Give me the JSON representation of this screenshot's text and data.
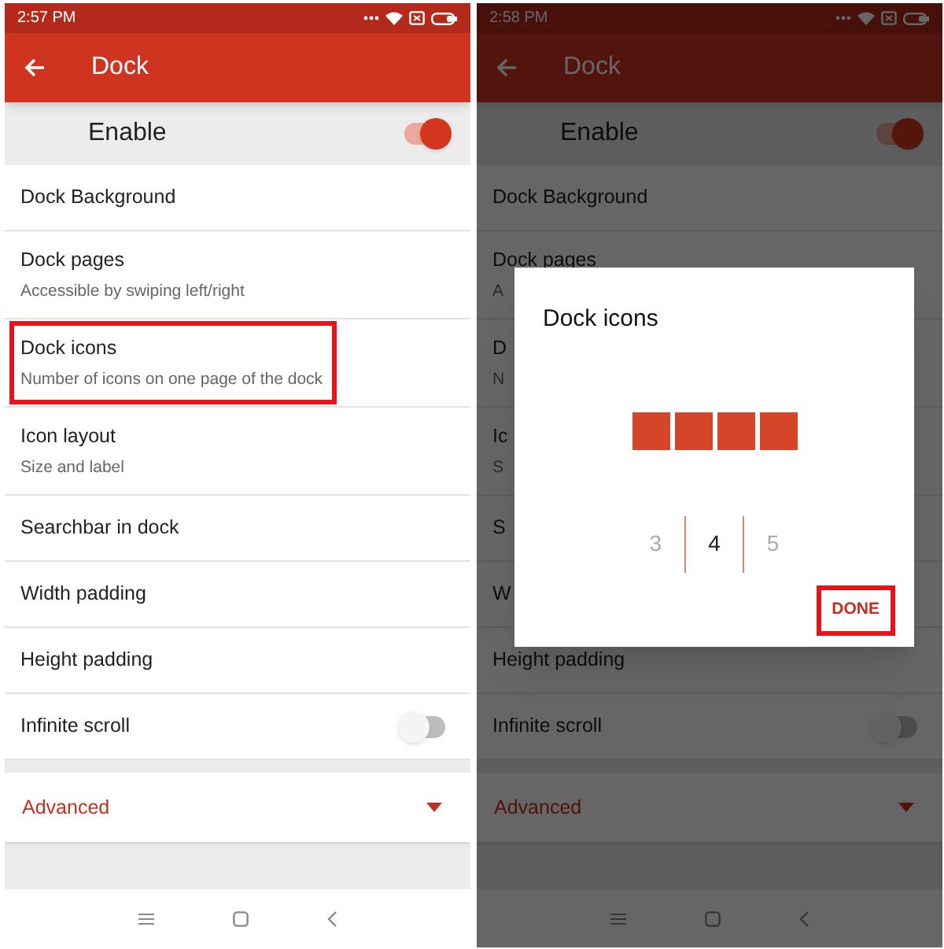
{
  "screens": [
    {
      "dimmed": false,
      "status_bar": {
        "time": "2:57 PM"
      },
      "app_bar": {
        "title": "Dock"
      },
      "enable": {
        "label": "Enable",
        "on": true
      },
      "items": [
        {
          "kind": "plain",
          "title": "Dock Background",
          "highlighted": false
        },
        {
          "kind": "plain",
          "title": "Dock pages",
          "subtitle": "Accessible by swiping left/right",
          "highlighted": false
        },
        {
          "kind": "plain",
          "title": "Dock icons",
          "subtitle": "Number of icons on one page of the dock",
          "highlighted": true
        },
        {
          "kind": "plain",
          "title": "Icon layout",
          "subtitle": "Size and label",
          "highlighted": false
        },
        {
          "kind": "plain",
          "title": "Searchbar in dock",
          "highlighted": false
        },
        {
          "kind": "plain",
          "title": "Width padding",
          "highlighted": false
        },
        {
          "kind": "plain",
          "title": "Height padding",
          "highlighted": false
        },
        {
          "kind": "toggle",
          "title": "Infinite scroll",
          "on": false,
          "highlighted": false
        }
      ],
      "section": {
        "label": "Advanced",
        "expanded": false
      }
    },
    {
      "dimmed": true,
      "status_bar": {
        "time": "2:58 PM"
      },
      "app_bar": {
        "title": "Dock"
      },
      "enable": {
        "label": "Enable",
        "on": true
      },
      "items": [
        {
          "kind": "plain",
          "title": "Dock Background",
          "highlighted": false
        },
        {
          "kind": "plain",
          "title": "Dock pages",
          "subtitle": "A",
          "highlighted": false
        },
        {
          "kind": "plain",
          "title": "D",
          "subtitle": "N",
          "highlighted": false
        },
        {
          "kind": "plain",
          "title": "Ic",
          "subtitle": "S",
          "highlighted": false
        },
        {
          "kind": "plain",
          "title": "S",
          "highlighted": false
        },
        {
          "kind": "plain",
          "title": "W",
          "highlighted": false
        },
        {
          "kind": "plain",
          "title": "Height padding",
          "highlighted": false
        },
        {
          "kind": "toggle",
          "title": "Infinite scroll",
          "on": false,
          "highlighted": false
        }
      ],
      "section": {
        "label": "Advanced",
        "expanded": false
      },
      "dialog": {
        "title": "Dock icons",
        "options": [
          {
            "label": "3",
            "selected": false
          },
          {
            "label": "4",
            "selected": true
          },
          {
            "label": "5",
            "selected": false
          }
        ],
        "button": {
          "label": "DONE",
          "highlighted": true
        }
      }
    }
  ]
}
